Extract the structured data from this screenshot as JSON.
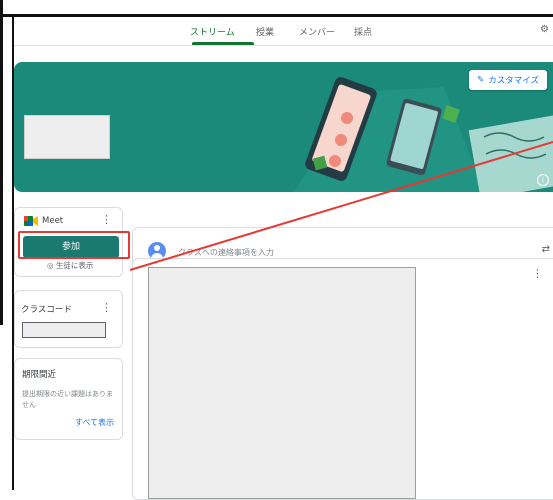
{
  "tabs": [
    "ストリーム",
    "授業",
    "メンバー",
    "採点"
  ],
  "banner": {
    "customize_label": "カスタマイズ",
    "info_icon": "info-icon",
    "pencil_icon": "pencil-icon"
  },
  "meet": {
    "title": "Meet",
    "join_label": "参加",
    "show_label": "生徒に表示"
  },
  "class_code": {
    "title": "クラスコード"
  },
  "upcoming": {
    "title": "期限間近",
    "text": "提出期限の近い課題はありません",
    "view_all": "すべて表示"
  },
  "post": {
    "placeholder": "クラスへの連絡事項を入力"
  },
  "colors": {
    "banner": "#1b8a7a",
    "join_button": "#1b7a70",
    "active_tab": "#137333",
    "highlight": "#e53935"
  }
}
